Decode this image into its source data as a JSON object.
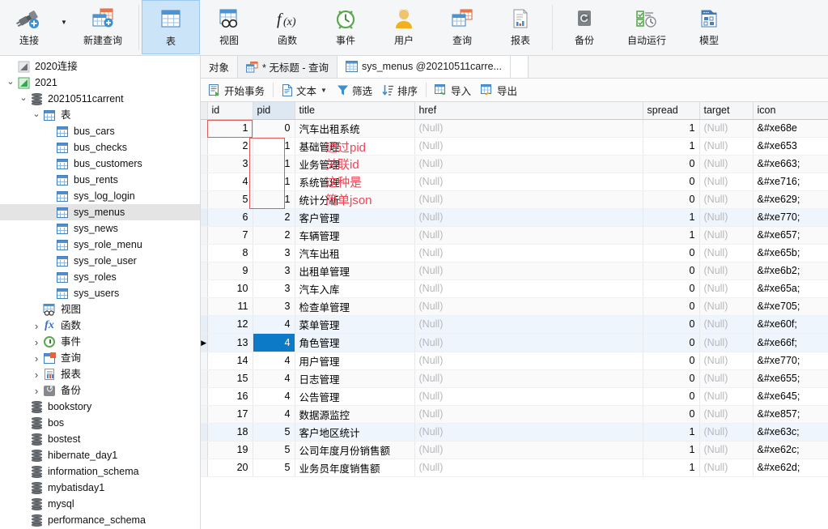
{
  "ribbon": {
    "groups": [
      {
        "items": [
          {
            "label": "连接",
            "icon": "connect-icon",
            "has_caret": true,
            "active": false
          },
          {
            "label": "新建查询",
            "icon": "new-query-icon",
            "active": false
          }
        ]
      },
      {
        "items": [
          {
            "label": "表",
            "icon": "table-icon",
            "active": true
          },
          {
            "label": "视图",
            "icon": "view-icon",
            "active": false
          },
          {
            "label": "函数",
            "icon": "function-icon",
            "active": false
          },
          {
            "label": "事件",
            "icon": "event-icon",
            "active": false
          },
          {
            "label": "用户",
            "icon": "user-icon",
            "active": false
          },
          {
            "label": "查询",
            "icon": "query-icon",
            "active": false
          },
          {
            "label": "报表",
            "icon": "report-icon",
            "active": false
          }
        ]
      },
      {
        "items": [
          {
            "label": "备份",
            "icon": "backup-icon",
            "active": false
          },
          {
            "label": "自动运行",
            "icon": "automation-icon",
            "active": false
          },
          {
            "label": "模型",
            "icon": "model-icon",
            "active": false
          }
        ]
      }
    ]
  },
  "sidebar": {
    "items": [
      {
        "label": "2020连接",
        "indent": 0,
        "icon": "connection-icon",
        "twisty": "",
        "selected": false
      },
      {
        "label": "2021",
        "indent": 0,
        "icon": "connection-open-icon",
        "twisty": "v",
        "selected": false
      },
      {
        "label": "20210511carrent",
        "indent": 1,
        "icon": "database-icon",
        "twisty": "v",
        "selected": false
      },
      {
        "label": "表",
        "indent": 2,
        "icon": "table-folder-icon",
        "twisty": "v",
        "selected": false
      },
      {
        "label": "bus_cars",
        "indent": 3,
        "icon": "table-icon",
        "twisty": "",
        "selected": false
      },
      {
        "label": "bus_checks",
        "indent": 3,
        "icon": "table-icon",
        "twisty": "",
        "selected": false
      },
      {
        "label": "bus_customers",
        "indent": 3,
        "icon": "table-icon",
        "twisty": "",
        "selected": false
      },
      {
        "label": "bus_rents",
        "indent": 3,
        "icon": "table-icon",
        "twisty": "",
        "selected": false
      },
      {
        "label": "sys_log_login",
        "indent": 3,
        "icon": "table-icon",
        "twisty": "",
        "selected": false
      },
      {
        "label": "sys_menus",
        "indent": 3,
        "icon": "table-icon",
        "twisty": "",
        "selected": true
      },
      {
        "label": "sys_news",
        "indent": 3,
        "icon": "table-icon",
        "twisty": "",
        "selected": false
      },
      {
        "label": "sys_role_menu",
        "indent": 3,
        "icon": "table-icon",
        "twisty": "",
        "selected": false
      },
      {
        "label": "sys_role_user",
        "indent": 3,
        "icon": "table-icon",
        "twisty": "",
        "selected": false
      },
      {
        "label": "sys_roles",
        "indent": 3,
        "icon": "table-icon",
        "twisty": "",
        "selected": false
      },
      {
        "label": "sys_users",
        "indent": 3,
        "icon": "table-icon",
        "twisty": "",
        "selected": false
      },
      {
        "label": "视图",
        "indent": 2,
        "icon": "view-icon",
        "twisty": "",
        "selected": false
      },
      {
        "label": "函数",
        "indent": 2,
        "icon": "function-icon",
        "twisty": ">",
        "selected": false
      },
      {
        "label": "事件",
        "indent": 2,
        "icon": "event-icon",
        "twisty": ">",
        "selected": false
      },
      {
        "label": "查询",
        "indent": 2,
        "icon": "query-icon",
        "twisty": ">",
        "selected": false
      },
      {
        "label": "报表",
        "indent": 2,
        "icon": "report-icon",
        "twisty": ">",
        "selected": false
      },
      {
        "label": "备份",
        "indent": 2,
        "icon": "backup-icon",
        "twisty": ">",
        "selected": false
      },
      {
        "label": "bookstory",
        "indent": 1,
        "icon": "database-icon",
        "twisty": "",
        "selected": false
      },
      {
        "label": "bos",
        "indent": 1,
        "icon": "database-icon",
        "twisty": "",
        "selected": false
      },
      {
        "label": "bostest",
        "indent": 1,
        "icon": "database-icon",
        "twisty": "",
        "selected": false
      },
      {
        "label": "hibernate_day1",
        "indent": 1,
        "icon": "database-icon",
        "twisty": "",
        "selected": false
      },
      {
        "label": "information_schema",
        "indent": 1,
        "icon": "database-icon",
        "twisty": "",
        "selected": false
      },
      {
        "label": "mybatisday1",
        "indent": 1,
        "icon": "database-icon",
        "twisty": "",
        "selected": false
      },
      {
        "label": "mysql",
        "indent": 1,
        "icon": "database-icon",
        "twisty": "",
        "selected": false
      },
      {
        "label": "performance_schema",
        "indent": 1,
        "icon": "database-icon",
        "twisty": "",
        "selected": false
      }
    ]
  },
  "tabs": {
    "object_label": "对象",
    "items": [
      {
        "label": "* 无标题 - 查询",
        "icon": "query-icon",
        "active": false
      },
      {
        "label": "sys_menus @20210511carre...",
        "icon": "table-icon",
        "active": true
      }
    ]
  },
  "action_toolbar": {
    "buttons": [
      {
        "label": "开始事务",
        "icon": "transaction-icon",
        "caret": false
      },
      {
        "label": "文本",
        "icon": "text-icon",
        "caret": true
      },
      {
        "label": "筛选",
        "icon": "filter-icon",
        "caret": false
      },
      {
        "label": "排序",
        "icon": "sort-icon",
        "caret": false
      },
      {
        "label": "导入",
        "icon": "import-icon",
        "caret": false
      },
      {
        "label": "导出",
        "icon": "export-icon",
        "caret": false
      }
    ]
  },
  "grid": {
    "columns": [
      "id",
      "pid",
      "title",
      "href",
      "spread",
      "target",
      "icon"
    ],
    "sorted_column": "pid",
    "null_text": "(Null)",
    "selected_row_index": 12,
    "selected_column": "pid",
    "rows": [
      {
        "id": "1",
        "pid": "0",
        "title": "汽车出租系统",
        "href": "(Null)",
        "spread": "1",
        "target": "(Null)",
        "icon": "&#xe68e"
      },
      {
        "id": "2",
        "pid": "1",
        "title": "基础管理",
        "href": "(Null)",
        "spread": "1",
        "target": "(Null)",
        "icon": "&#xe653"
      },
      {
        "id": "3",
        "pid": "1",
        "title": "业务管理",
        "href": "(Null)",
        "spread": "0",
        "target": "(Null)",
        "icon": "&#xe663;"
      },
      {
        "id": "4",
        "pid": "1",
        "title": "系统管理",
        "href": "(Null)",
        "spread": "0",
        "target": "(Null)",
        "icon": "&#xe716;"
      },
      {
        "id": "5",
        "pid": "1",
        "title": "统计分析",
        "href": "(Null)",
        "spread": "0",
        "target": "(Null)",
        "icon": "&#xe629;"
      },
      {
        "id": "6",
        "pid": "2",
        "title": "客户管理",
        "href": "(Null)",
        "spread": "1",
        "target": "(Null)",
        "icon": "&#xe770;"
      },
      {
        "id": "7",
        "pid": "2",
        "title": "车辆管理",
        "href": "(Null)",
        "spread": "1",
        "target": "(Null)",
        "icon": "&#xe657;"
      },
      {
        "id": "8",
        "pid": "3",
        "title": "汽车出租",
        "href": "(Null)",
        "spread": "0",
        "target": "(Null)",
        "icon": "&#xe65b;"
      },
      {
        "id": "9",
        "pid": "3",
        "title": "出租单管理",
        "href": "(Null)",
        "spread": "0",
        "target": "(Null)",
        "icon": "&#xe6b2;"
      },
      {
        "id": "10",
        "pid": "3",
        "title": "汽车入库",
        "href": "(Null)",
        "spread": "0",
        "target": "(Null)",
        "icon": "&#xe65a;"
      },
      {
        "id": "11",
        "pid": "3",
        "title": "检查单管理",
        "href": "(Null)",
        "spread": "0",
        "target": "(Null)",
        "icon": "&#xe705;"
      },
      {
        "id": "12",
        "pid": "4",
        "title": "菜单管理",
        "href": "(Null)",
        "spread": "0",
        "target": "(Null)",
        "icon": "&#xe60f;"
      },
      {
        "id": "13",
        "pid": "4",
        "title": "角色管理",
        "href": "(Null)",
        "spread": "0",
        "target": "(Null)",
        "icon": "&#xe66f;"
      },
      {
        "id": "14",
        "pid": "4",
        "title": "用户管理",
        "href": "(Null)",
        "spread": "0",
        "target": "(Null)",
        "icon": "&#xe770;"
      },
      {
        "id": "15",
        "pid": "4",
        "title": "日志管理",
        "href": "(Null)",
        "spread": "0",
        "target": "(Null)",
        "icon": "&#xe655;"
      },
      {
        "id": "16",
        "pid": "4",
        "title": "公告管理",
        "href": "(Null)",
        "spread": "0",
        "target": "(Null)",
        "icon": "&#xe645;"
      },
      {
        "id": "17",
        "pid": "4",
        "title": "数据源监控",
        "href": "(Null)",
        "spread": "0",
        "target": "(Null)",
        "icon": "&#xe857;"
      },
      {
        "id": "18",
        "pid": "5",
        "title": "客户地区统计",
        "href": "(Null)",
        "spread": "1",
        "target": "(Null)",
        "icon": "&#xe63c;"
      },
      {
        "id": "19",
        "pid": "5",
        "title": "公司年度月份销售额",
        "href": "(Null)",
        "spread": "1",
        "target": "(Null)",
        "icon": "&#xe62c;"
      },
      {
        "id": "20",
        "pid": "5",
        "title": "业务员年度销售额",
        "href": "(Null)",
        "spread": "1",
        "target": "(Null)",
        "icon": "&#xe62d;"
      }
    ]
  },
  "annotations": {
    "color": "#ef4557",
    "lines": [
      "通过pid",
      "关联id",
      "这种是",
      "简单json"
    ]
  }
}
